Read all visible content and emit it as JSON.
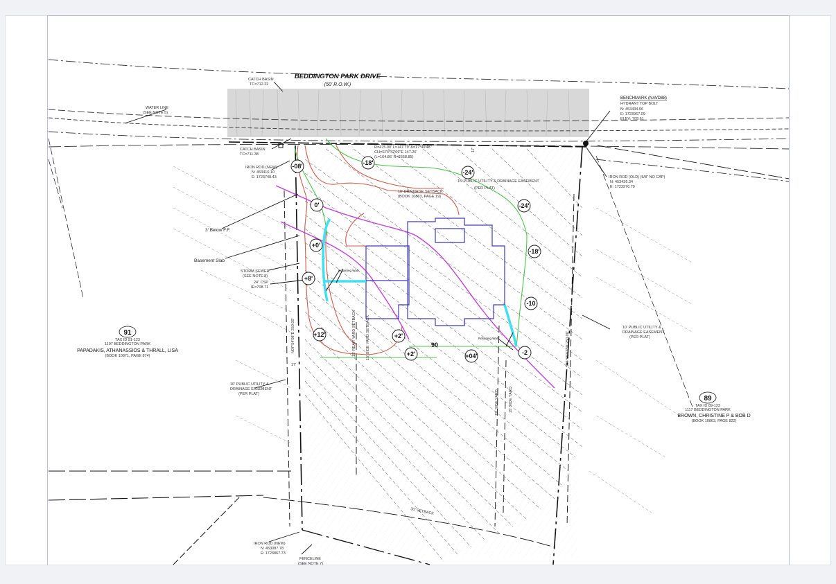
{
  "road": {
    "name": "BEDDINGTON PARK DRIVE",
    "row": "(50' R.O.W.)"
  },
  "notes": {
    "catch_basin_top": "CATCH BASIN",
    "catch_basin_top_elev": "TC=712.22",
    "catch_basin_left": "CATCH BASIN",
    "catch_basin_left_elev": "TC=711.38",
    "water_line": "WATER LINE",
    "water_line_ref": "(SEE NOTE 5)",
    "iron_rod_left": "IRON ROD (NEW)",
    "iron_rod_left_n": "N: 453416.10",
    "iron_rod_left_e": "E: 1723748.43",
    "three_below_ff": "3' Below F.F.",
    "basement_slab": "Basement Slab",
    "storm_sewer": "STORM SEWER",
    "storm_sewer_ref": "(SEE NOTE 8)",
    "storm_invert": "24\" CSP",
    "storm_invert_elev": "IE=708.71",
    "curve_data_1": "R=475.00'  L=147.79'  Δ=17°49'48\"",
    "curve_data_2": "CH=S74°42'09\"E 147.26'",
    "curve_data_3": "(L=164.86'  R=2558.85)",
    "easement_center": "15' PUBLIC UTILITY & DRAINAGE EASEMENT",
    "easement_center_ref": "(PER PLAT)",
    "restriction_note": "10' DRAINAGE SETBACK",
    "restriction_ref": "(BOOK 10863, PAGE 19)",
    "retaining_wall_left": "Retaining Wall",
    "retaining_wall_right": "Retaining Wall",
    "benchmark_title": "BENCHMARK (NAVD88)",
    "benchmark_desc": "HYDRANT TOP BOLT",
    "benchmark_n": "N: 453434.06",
    "benchmark_e": "E: 1723967.09",
    "benchmark_elev": "ELEV: 709.61",
    "iron_rod_right": "IRON ROD (OLD) (5/8\" NO CAP)",
    "iron_rod_right_n": "N: 453436.34",
    "iron_rod_right_e": "E: 1723976.79",
    "easement_right": "10' PUBLIC UTILITY &",
    "easement_right_2": "DRAINAGE EASEMENT",
    "easement_right_ref": "(PER PLAT)",
    "easement_left": "10' PUBLIC UTILITY &",
    "easement_left_2": "DRAINAGE EASEMENT",
    "easement_left_ref": "(PER PLAT)",
    "setback_rear": "30' SETBACK",
    "iron_rod_bottom": "IRON ROD (NEW)",
    "iron_rod_bottom_n": "N: 453087.78",
    "iron_rod_bottom_e": "E: 1723867.73",
    "fence_line": "FENCELINE",
    "fence_line_ref": "(SEE NOTE 7)",
    "line_label_left": "N07°54'08\"E  250.00'",
    "line_label_mid_left": "15' REAR YARD SETBACK",
    "line_label_mid_right": "15' SIDE YARD SETBACK",
    "line_label_right_1": "15' SIDE YARD",
    "line_label_right_2": "S04°05'52\"W  250.00'",
    "dim_17_left": "17'",
    "dim_17_top": "17'",
    "dim_90": "90"
  },
  "lots": {
    "left": {
      "number": "91",
      "subtitle": "TAX ID 91-123",
      "address": "1107 BEDDINGTON PARK",
      "owner": "PAPADAKIS, ATHANASSIOS & THRALL, LISA",
      "ref": "(BOOK 10871, PAGE 874)"
    },
    "right": {
      "number": "89",
      "subtitle": "TAX ID 89-123",
      "address": "1117 BEDDINGTON PARK",
      "owner": "BROWN, CHRISTINE P & BOB D",
      "ref": "(BOOK 10863, PAGE 822)"
    }
  },
  "grade_markers": [
    {
      "id": "m1",
      "label": "-08'"
    },
    {
      "id": "m2",
      "label": "-18'"
    },
    {
      "id": "m3",
      "label": "-24'"
    },
    {
      "id": "m4",
      "label": "0'"
    },
    {
      "id": "m5",
      "label": "-24'"
    },
    {
      "id": "m6",
      "label": "+0'"
    },
    {
      "id": "m7",
      "label": "-18'"
    },
    {
      "id": "m8",
      "label": "+8'"
    },
    {
      "id": "m9",
      "label": "-10"
    },
    {
      "id": "m10",
      "label": "+12'"
    },
    {
      "id": "m11",
      "label": "+2'"
    },
    {
      "id": "m12",
      "label": "+2'"
    },
    {
      "id": "m13",
      "label": "+04'"
    },
    {
      "id": "m14",
      "label": "-2"
    }
  ],
  "colors": {
    "road_fill": "#d8d8d8",
    "house_outline": "#3a3ab8",
    "sewer_line": "#c040d8",
    "contour_red": "#d05a4a",
    "contour_green": "#4cc44c",
    "retaining_wall": "#40e0f0"
  }
}
